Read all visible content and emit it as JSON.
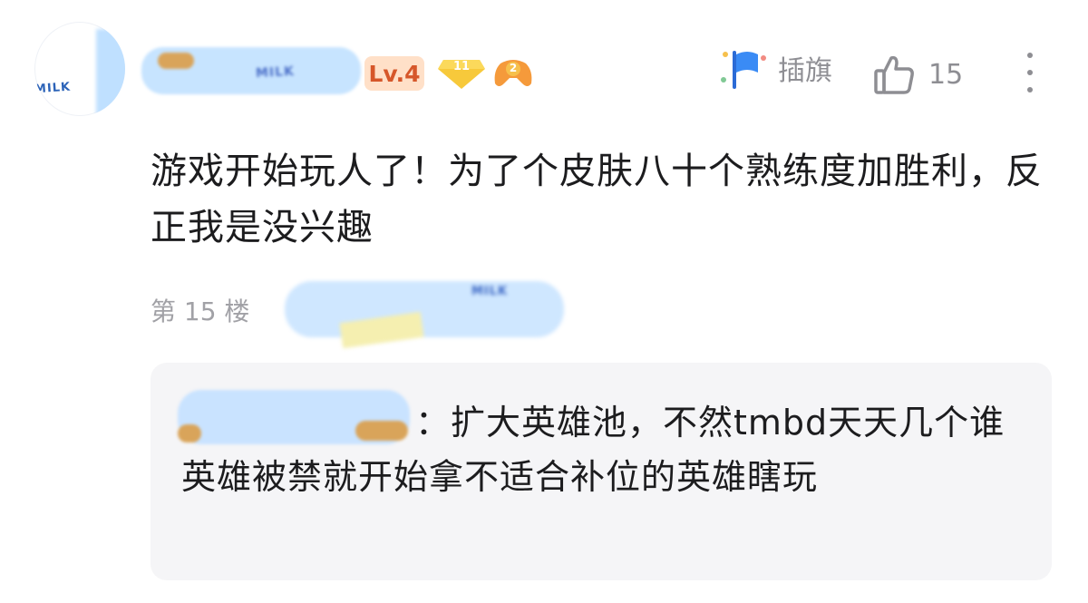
{
  "header": {
    "avatar_text": "MILK",
    "username_text": "MILK",
    "level": "Lv.4",
    "gem_badge": "11",
    "game_badge": "2",
    "flag_label": "插旗",
    "like_count": "15"
  },
  "comment": {
    "text": "游戏开始玩人了！为了个皮肤八十个熟练度加胜利，反正我是没兴趣",
    "floor": "第 15 楼",
    "floor_blur_text": "MILK"
  },
  "reply": {
    "separator": "：",
    "text": "扩大英雄池，不然tmbd天天几个谁英雄被禁就开始拿不适合补位的英雄瞎玩"
  },
  "colors": {
    "level_bg": "#ffe0c8",
    "level_fg": "#d6572a",
    "meta_gray": "#8e8e93",
    "reply_bg": "#f5f5f7",
    "blur_blue": "#c7e4ff"
  },
  "icons": [
    "flag-icon",
    "thumbs-up-icon",
    "more-vertical-icon",
    "gem-icon",
    "game-controller-icon"
  ]
}
